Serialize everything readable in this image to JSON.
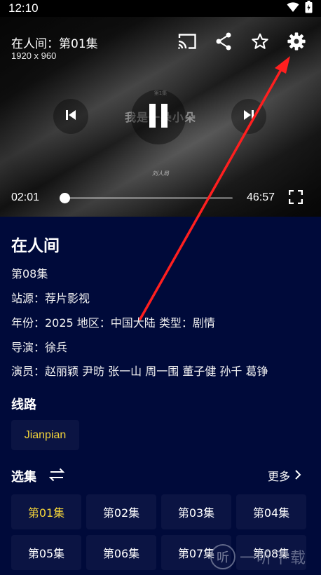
{
  "status": {
    "time": "12:10"
  },
  "player": {
    "episode_title": "在人间：第01集",
    "resolution": "1920 x 960",
    "frame_small": "第1集",
    "frame_main": "我是一朵小朵",
    "frame_sign": "刘人局",
    "current_time": "02:01",
    "total_time": "46:57",
    "progress": 0.0
  },
  "info": {
    "title": "在人间",
    "episode": "第08集",
    "source": "站源：荐片影视",
    "meta": "年份：2025  地区：中国大陆  类型：剧情",
    "director": "导演：徐兵",
    "cast": "演员：赵丽颖 尹昉 张一山 周一围 董子健 孙千 葛铮"
  },
  "routes": {
    "title": "线路",
    "items": [
      "Jianpian"
    ]
  },
  "episodes": {
    "title": "选集",
    "more_label": "更多",
    "items": [
      "第01集",
      "第02集",
      "第03集",
      "第04集",
      "第05集",
      "第06集",
      "第07集",
      "第08集"
    ],
    "active_index": 0
  },
  "watermark": {
    "logo_char": "听",
    "text": "一听下载"
  },
  "colors": {
    "background": "#000a3a",
    "chip": "#0b1443",
    "accent": "#f3d43a",
    "annotation_arrow": "#ff1f1f"
  },
  "icons": [
    "wifi-icon",
    "battery-icon",
    "cast-icon",
    "share-icon",
    "star-icon",
    "settings-icon",
    "skip-previous-icon",
    "pause-icon",
    "skip-next-icon",
    "fullscreen-icon",
    "swap-icon",
    "chevron-right-icon"
  ]
}
